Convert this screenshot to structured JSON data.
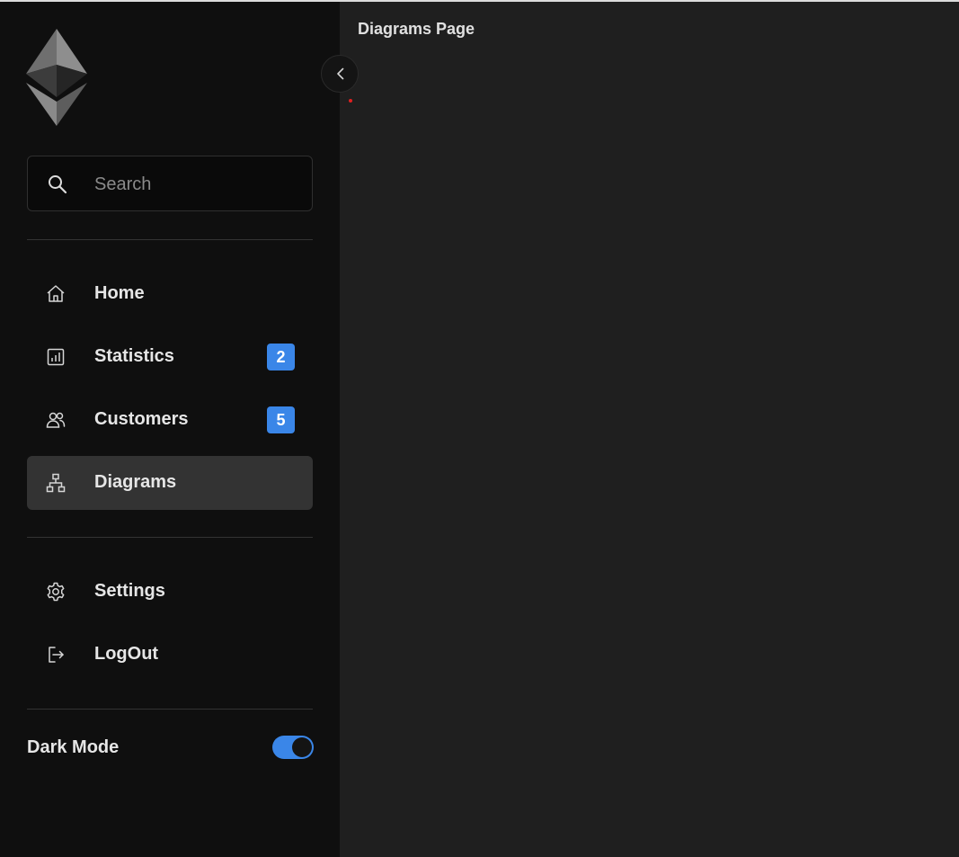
{
  "logo": {
    "icon": "ethereum-logo"
  },
  "search": {
    "placeholder": "Search",
    "value": "",
    "icon": "search-icon"
  },
  "nav": {
    "items": [
      {
        "label": "Home",
        "icon": "home-icon",
        "badge": ""
      },
      {
        "label": "Statistics",
        "icon": "chart-icon",
        "badge": "2"
      },
      {
        "label": "Customers",
        "icon": "users-icon",
        "badge": "5"
      },
      {
        "label": "Diagrams",
        "icon": "sitemap-icon",
        "badge": "",
        "active": true
      }
    ],
    "secondary": [
      {
        "label": "Settings",
        "icon": "gear-icon"
      },
      {
        "label": "LogOut",
        "icon": "logout-icon"
      }
    ]
  },
  "dark_mode": {
    "label": "Dark Mode",
    "enabled": true
  },
  "main": {
    "title": "Diagrams Page"
  },
  "colors": {
    "accent": "#3a86e8",
    "sidebar_bg": "#0f0f0f",
    "main_bg": "#1f1f1f",
    "active_bg": "#333333"
  }
}
